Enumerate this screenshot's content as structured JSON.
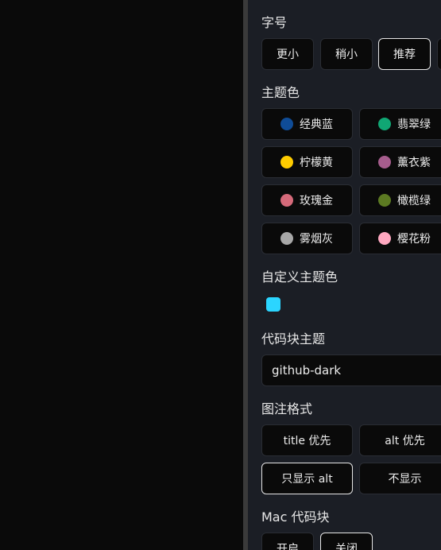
{
  "font_size": {
    "title": "字号",
    "options": [
      "更小",
      "稍小",
      "推荐"
    ],
    "selected": "推荐"
  },
  "theme_color": {
    "title": "主题色",
    "options": [
      {
        "label": "经典蓝",
        "color": "#0f4c97"
      },
      {
        "label": "翡翠绿",
        "color": "#10a774"
      },
      {
        "label": "柠檬黄",
        "color": "#ffcc00"
      },
      {
        "label": "薰衣紫",
        "color": "#a65d8d"
      },
      {
        "label": "玫瑰金",
        "color": "#d56a7a"
      },
      {
        "label": "橄榄绿",
        "color": "#5c7a22"
      },
      {
        "label": "雾烟灰",
        "color": "#a8a8a8"
      },
      {
        "label": "樱花粉",
        "color": "#ffa8c0"
      }
    ]
  },
  "custom_theme_color": {
    "title": "自定义主题色",
    "value": "#2bd5ff"
  },
  "code_block_theme": {
    "title": "代码块主题",
    "value": "github-dark"
  },
  "caption_format": {
    "title": "图注格式",
    "options": [
      "title 优先",
      "alt 优先",
      "只显示 alt",
      "不显示"
    ],
    "selected": "只显示 alt"
  },
  "mac_code_block": {
    "title": "Mac 代码块",
    "options": [
      "开启",
      "关闭"
    ],
    "selected": "关闭"
  }
}
